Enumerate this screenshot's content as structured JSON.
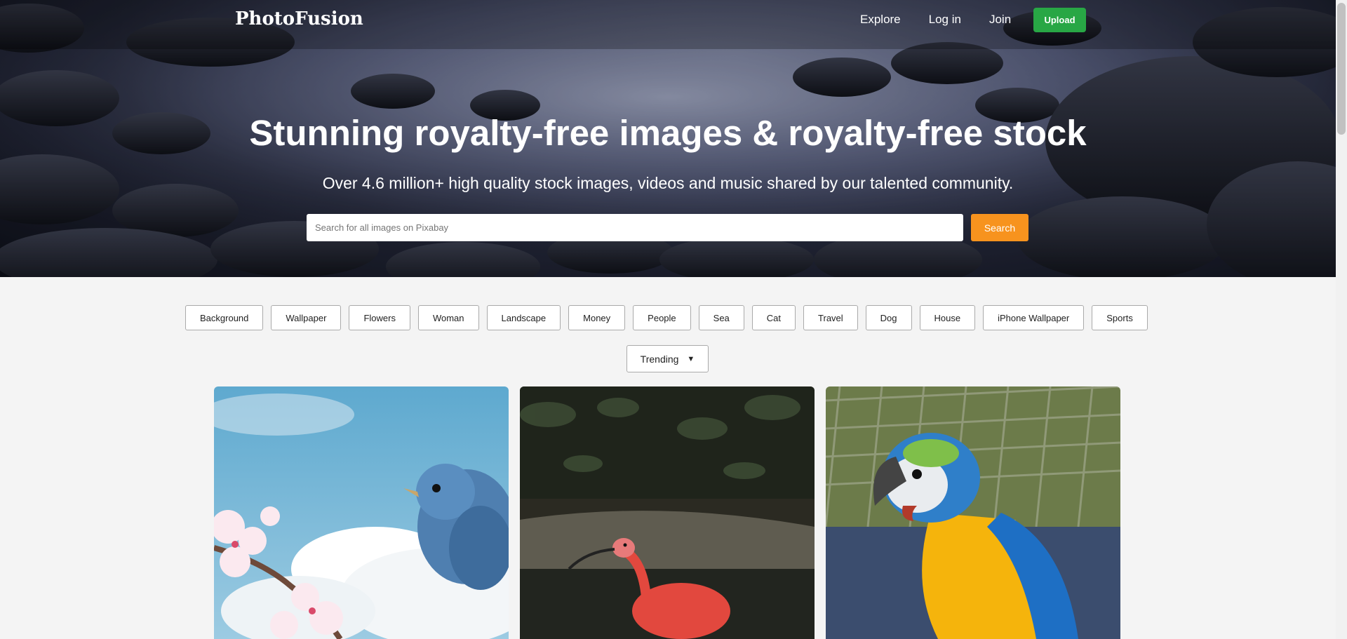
{
  "brand": {
    "logo": "PhotoFusion"
  },
  "nav": {
    "links": [
      "Explore",
      "Log in",
      "Join"
    ],
    "upload_label": "Upload",
    "upload_color": "#28a745"
  },
  "hero": {
    "title": "Stunning royalty-free images & royalty-free stock",
    "subtitle": "Over 4.6 million+ high quality stock images, videos and music shared by our talented community.",
    "search": {
      "placeholder": "Search for all images on Pixabay",
      "value": ""
    },
    "search_button": "Search",
    "search_button_color": "#f7931e"
  },
  "tags": [
    "Background",
    "Wallpaper",
    "Flowers",
    "Woman",
    "Landscape",
    "Money",
    "People",
    "Sea",
    "Cat",
    "Travel",
    "Dog",
    "House",
    "iPhone Wallpaper",
    "Sports"
  ],
  "sort": {
    "selected": "Trending"
  },
  "gallery": [
    {
      "subject": "blue bird on cherry blossom branch"
    },
    {
      "subject": "scarlet ibis wading"
    },
    {
      "subject": "blue and yellow macaw"
    }
  ]
}
